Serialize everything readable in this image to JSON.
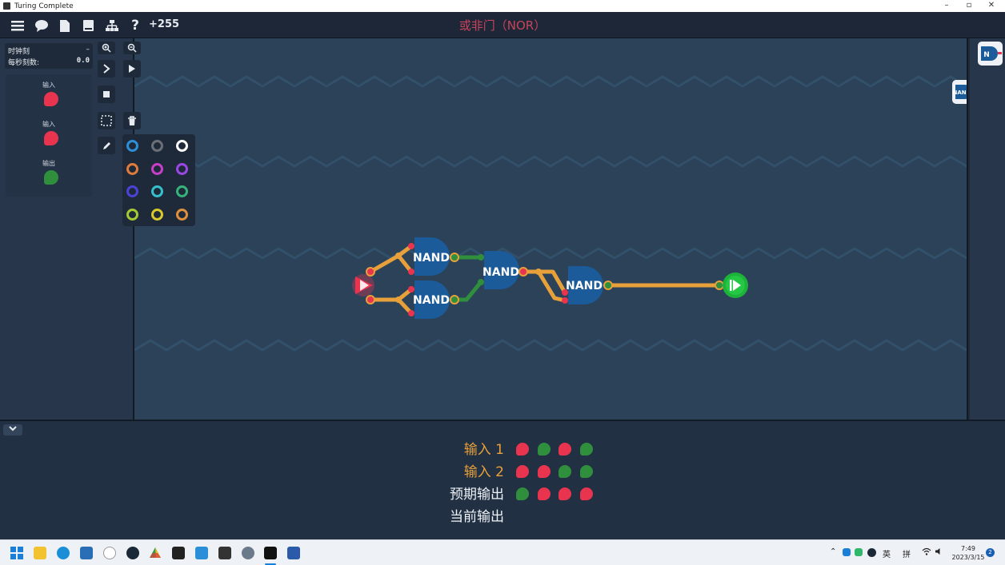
{
  "window": {
    "title": "Turing Complete"
  },
  "toolbar": {
    "score": "+255",
    "help_label": "?"
  },
  "level": {
    "title": "或非门（NOR）"
  },
  "clock": {
    "label": "时钟刻",
    "label_value": "–",
    "rate_label": "每秒刻数:",
    "rate_value": "0.0"
  },
  "io_panel": {
    "items": [
      {
        "label": "输入",
        "color": "#e8344f"
      },
      {
        "label": "输入",
        "color": "#e8344f"
      },
      {
        "label": "输出",
        "color": "#2f8f3c"
      }
    ]
  },
  "gates": [
    "NAND",
    "NAND",
    "NAND",
    "NAND"
  ],
  "component_buttons": [
    "NAND",
    "N"
  ],
  "wire_colors": [
    "#2e8ed6",
    "#6b6f78",
    "#ffffff",
    "#e07b3c",
    "#c93ec9",
    "#9b47e6",
    "#4a44d6",
    "#36c0cc",
    "#35b37a",
    "#a6c933",
    "#d9c92b",
    "#e0903c"
  ],
  "truth_table": {
    "rows": [
      {
        "label": "输入 1",
        "color": "#e8a13a",
        "states": [
          "red",
          "green",
          "red",
          "green"
        ]
      },
      {
        "label": "输入 2",
        "color": "#e8a13a",
        "states": [
          "red",
          "red",
          "green",
          "green"
        ]
      },
      {
        "label": "预期输出",
        "color": "#eef2f6",
        "states": [
          "green",
          "red",
          "red",
          "red"
        ]
      },
      {
        "label": "当前输出",
        "color": "#eef2f6",
        "states": []
      }
    ],
    "state_colors": {
      "red": "#e8344f",
      "green": "#2f8f3c"
    }
  },
  "taskbar": {
    "lang": "英",
    "ime": "拼",
    "time": "7:49",
    "date": "2023/3/15",
    "notifications": "2"
  }
}
